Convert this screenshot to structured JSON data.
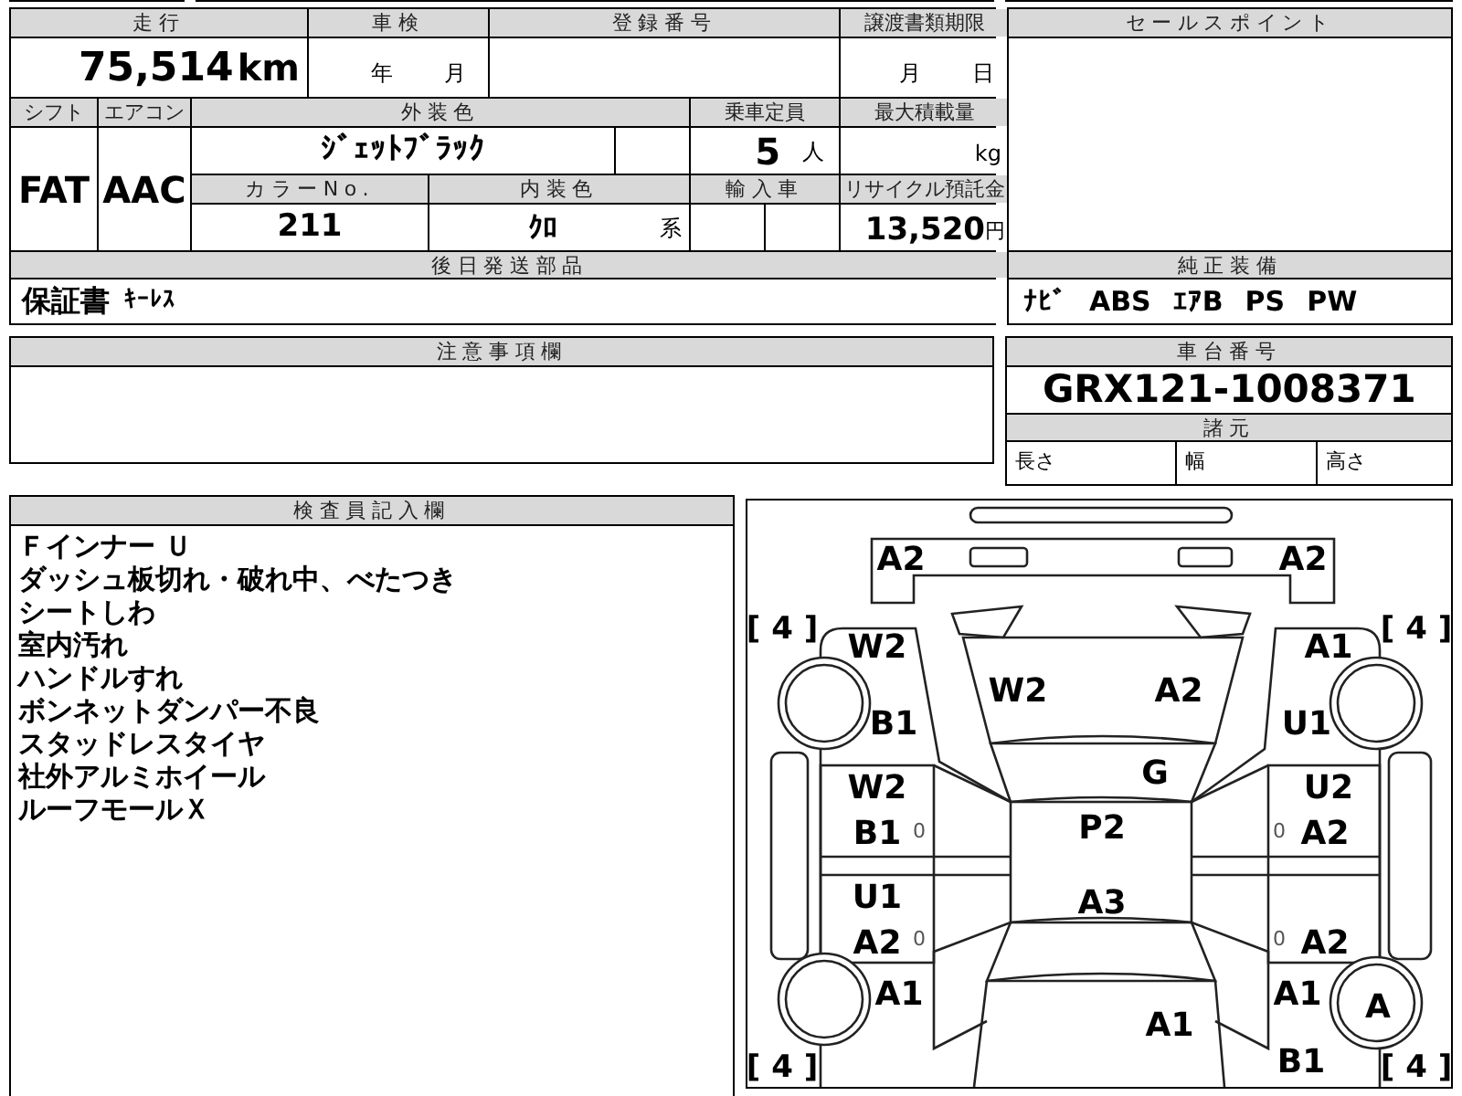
{
  "vehicle_table": {
    "mileage": {
      "label": "走行",
      "value": "75,514",
      "unit": "km"
    },
    "inspection": {
      "label": "車検",
      "year_unit": "年",
      "month_unit": "月"
    },
    "registration_number": {
      "label": "登録番号"
    },
    "transfer_deadline": {
      "label": "譲渡書類期限",
      "month_unit": "月",
      "day_unit": "日"
    },
    "shift": {
      "label": "シフト",
      "value": "FAT"
    },
    "air_conditioner": {
      "label": "エアコン",
      "value": "AAC"
    },
    "exterior_color": {
      "label": "外装色",
      "value": "ｼﾞｪｯﾄﾌﾞﾗｯｸ"
    },
    "capacity": {
      "label": "乗車定員",
      "value": "5",
      "unit": "人"
    },
    "max_load": {
      "label": "最大積載量",
      "unit": "kg"
    },
    "color_number": {
      "label": "カラーNo.",
      "value": "211"
    },
    "interior_color": {
      "label": "内装色",
      "value": "ｸﾛ",
      "suffix": "系"
    },
    "imported": {
      "label": "輸入車"
    },
    "recycling_fee": {
      "label": "リサイクル預託金",
      "value": "13,520",
      "unit": "円"
    },
    "parts_to_follow": {
      "label": "後日発送部品",
      "items": [
        "保証書",
        "ｷｰﾚｽ"
      ]
    }
  },
  "sales_point": {
    "label": "セールスポイント"
  },
  "genuine_equipment": {
    "label": "純正装備",
    "items": [
      "ﾅﾋﾞ",
      "ABS",
      "ｴｱB",
      "PS",
      "PW"
    ]
  },
  "notes": {
    "label": "注意事項欄"
  },
  "chassis": {
    "label": "車台番号",
    "value": "GRX121-1008371",
    "specs_label": "諸元",
    "specs": [
      "長さ",
      "幅",
      "高さ"
    ]
  },
  "inspector_notes": {
    "label": "検査員記入欄",
    "lines": [
      "Ｆインナー Ｕ",
      "ダッシュ板切れ・破れ中、べたつき",
      "シートしわ",
      "室内汚れ",
      "ハンドルすれ",
      "ボンネットダンパー不良",
      "スタッドレスタイヤ",
      "社外アルミホイール",
      "ルーフモールＸ"
    ]
  },
  "damage_diagram": {
    "marks": [
      {
        "kind": "grade",
        "text": "A2"
      },
      {
        "kind": "grade",
        "text": "A2"
      },
      {
        "kind": "tire",
        "text": "[ 4 ]"
      },
      {
        "kind": "tire",
        "text": "[ 4 ]"
      },
      {
        "kind": "grade",
        "text": "W2"
      },
      {
        "kind": "grade",
        "text": "A1"
      },
      {
        "kind": "grade",
        "text": "W2"
      },
      {
        "kind": "grade",
        "text": "A2"
      },
      {
        "kind": "grade",
        "text": "B1"
      },
      {
        "kind": "grade",
        "text": "U1"
      },
      {
        "kind": "grade",
        "text": "G"
      },
      {
        "kind": "grade",
        "text": "W2"
      },
      {
        "kind": "grade",
        "text": "U2"
      },
      {
        "kind": "grade",
        "text": "B1"
      },
      {
        "kind": "small",
        "text": "0"
      },
      {
        "kind": "grade",
        "text": "P2"
      },
      {
        "kind": "small",
        "text": "0"
      },
      {
        "kind": "grade",
        "text": "A2"
      },
      {
        "kind": "grade",
        "text": "U1"
      },
      {
        "kind": "grade",
        "text": "A3"
      },
      {
        "kind": "grade",
        "text": "A2"
      },
      {
        "kind": "small",
        "text": "0"
      },
      {
        "kind": "small",
        "text": "0"
      },
      {
        "kind": "grade",
        "text": "A2"
      },
      {
        "kind": "grade",
        "text": "A1"
      },
      {
        "kind": "grade",
        "text": "A1"
      },
      {
        "kind": "grade",
        "text": "A"
      },
      {
        "kind": "grade",
        "text": "A1"
      },
      {
        "kind": "tire",
        "text": "[ 4 ]"
      },
      {
        "kind": "grade",
        "text": "B1"
      },
      {
        "kind": "tire",
        "text": "[ 4 ]"
      }
    ]
  }
}
